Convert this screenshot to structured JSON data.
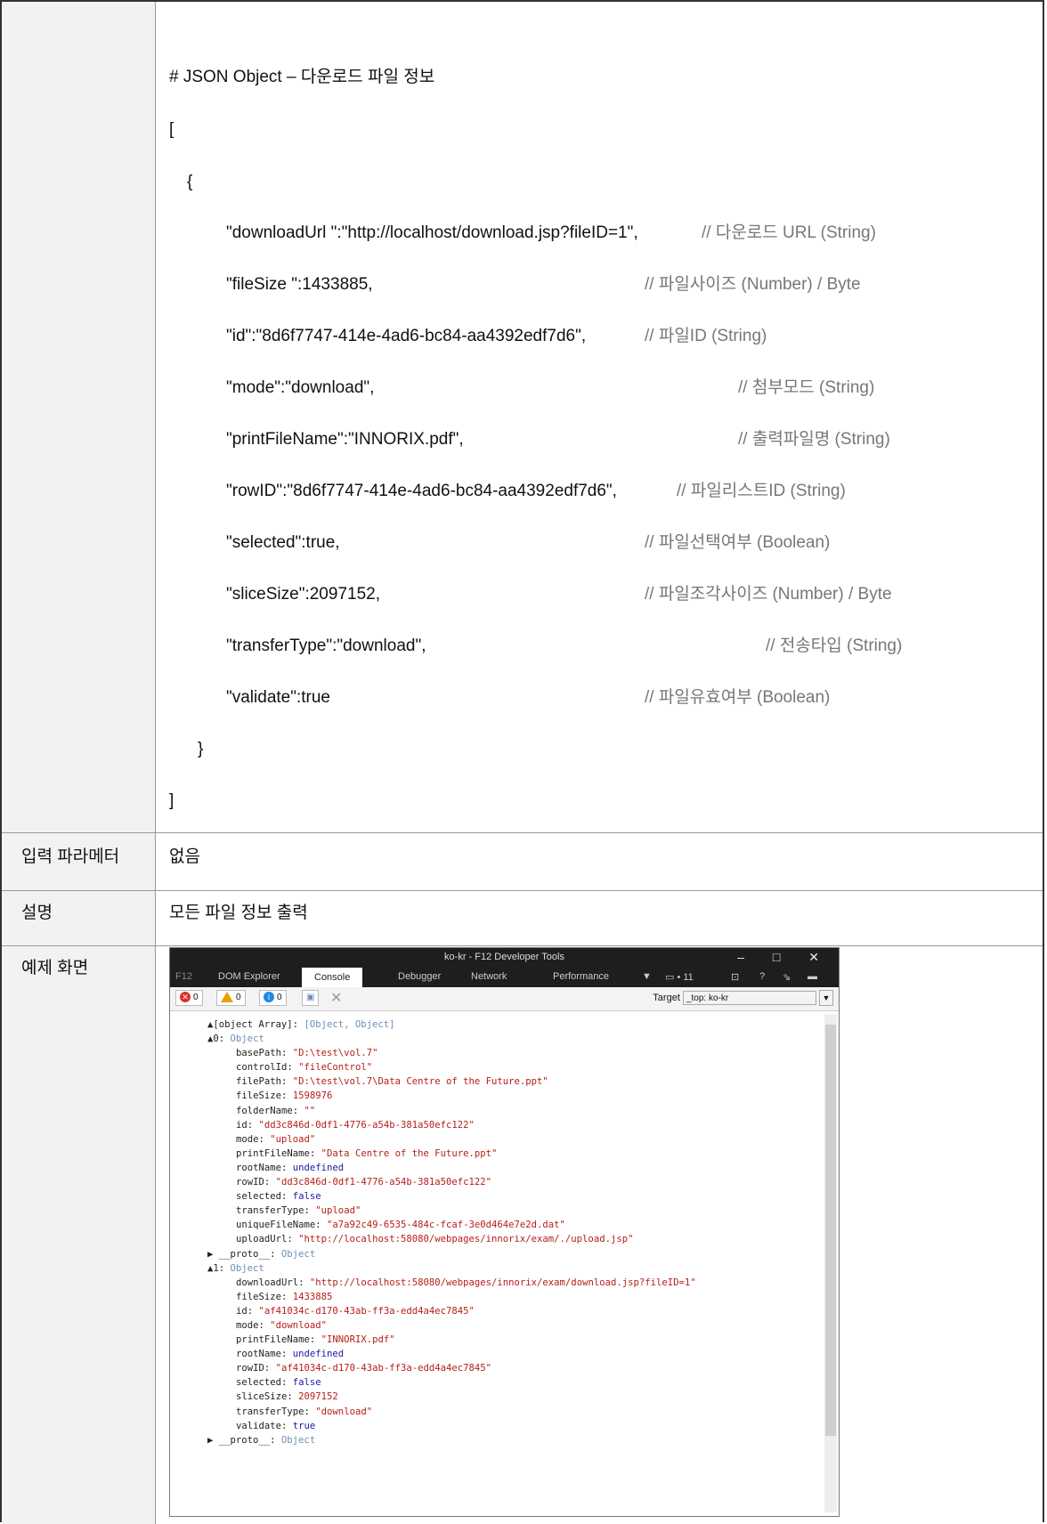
{
  "code_block": {
    "heading": "# JSON Object – 다운로드 파일 정보",
    "open_bracket": "[",
    "open_brace": "{",
    "lines": [
      {
        "code": "\"downloadUrl \":\"http://localhost/download.jsp?fileID=1\",",
        "comment": "// 다운로드 URL (String)"
      },
      {
        "code": "\"fileSize \":1433885,",
        "comment": "// 파일사이즈 (Number) / Byte"
      },
      {
        "code": "\"id\":\"8d6f7747-414e-4ad6-bc84-aa4392edf7d6\",",
        "comment": "// 파일ID (String)"
      },
      {
        "code": "\"mode\":\"download\",",
        "comment": "// 첨부모드 (String)"
      },
      {
        "code": "\"printFileName\":\"INNORIX.pdf\",",
        "comment": "// 출력파일명 (String)"
      },
      {
        "code": "\"rowID\":\"8d6f7747-414e-4ad6-bc84-aa4392edf7d6\",",
        "comment": "// 파일리스트ID (String)"
      },
      {
        "code": "\"selected\":true,",
        "comment": "// 파일선택여부 (Boolean)"
      },
      {
        "code": "\"sliceSize\":2097152,",
        "comment": "// 파일조각사이즈 (Number) / Byte"
      },
      {
        "code": "\"transferType\":\"download\",",
        "comment": "// 전송타입 (String)"
      },
      {
        "code": "\"validate\":true",
        "comment": "// 파일유효여부 (Boolean)"
      }
    ],
    "close_brace": "}",
    "close_bracket": "]"
  },
  "rows": {
    "input_label": "입력 파라메터",
    "input_value": "없음",
    "desc_label": "설명",
    "desc_value": "모든 파일 정보 출력",
    "example_label": "예제 화면"
  },
  "devtools": {
    "title": "ko-kr - F12 Developer Tools",
    "window_controls": "– □ ✕",
    "tabs": [
      "F12",
      "DOM Explorer",
      "Console",
      "Debugger",
      "Network",
      "Performance",
      "▼",
      "▭ • 11",
      "⊡",
      "?",
      "⇘",
      "▬"
    ],
    "errors": "0",
    "warnings": "0",
    "infos": "0",
    "target_label": "Target",
    "target_value": "_top: ko-kr",
    "console_lines": [
      {
        "indent": 1,
        "key": "▲[object Array]:",
        "val": " [Object, Object]",
        "t": "o"
      },
      {
        "indent": 1,
        "key": "  ▲0:",
        "val": " Object",
        "t": "o"
      },
      {
        "indent": 2,
        "key": "basePath:",
        "val": " \"D:\\test\\vol.7\"",
        "t": "s"
      },
      {
        "indent": 2,
        "key": "controlId:",
        "val": " \"fileControl\"",
        "t": "s"
      },
      {
        "indent": 2,
        "key": "filePath:",
        "val": " \"D:\\test\\vol.7\\Data Centre of the Future.ppt\"",
        "t": "s"
      },
      {
        "indent": 2,
        "key": "fileSize:",
        "val": " 1598976",
        "t": "s"
      },
      {
        "indent": 2,
        "key": "folderName:",
        "val": " \"\"",
        "t": "s"
      },
      {
        "indent": 2,
        "key": "id:",
        "val": " \"dd3c846d-0df1-4776-a54b-381a50efc122\"",
        "t": "s"
      },
      {
        "indent": 2,
        "key": "mode:",
        "val": " \"upload\"",
        "t": "s"
      },
      {
        "indent": 2,
        "key": "printFileName:",
        "val": " \"Data Centre of the Future.ppt\"",
        "t": "s"
      },
      {
        "indent": 2,
        "key": "rootName:",
        "val": " undefined",
        "t": "n"
      },
      {
        "indent": 2,
        "key": "rowID:",
        "val": " \"dd3c846d-0df1-4776-a54b-381a50efc122\"",
        "t": "s"
      },
      {
        "indent": 2,
        "key": "selected:",
        "val": " false",
        "t": "n"
      },
      {
        "indent": 2,
        "key": "transferType:",
        "val": " \"upload\"",
        "t": "s"
      },
      {
        "indent": 2,
        "key": "uniqueFileName:",
        "val": " \"a7a92c49-6535-484c-fcaf-3e0d464e7e2d.dat\"",
        "t": "s"
      },
      {
        "indent": 2,
        "key": "uploadUrl:",
        "val": " \"http://localhost:58080/webpages/innorix/exam/./upload.jsp\"",
        "t": "s"
      },
      {
        "indent": 1,
        "key": "     ▶ __proto__:",
        "val": " Object",
        "t": "o"
      },
      {
        "indent": 1,
        "key": "  ▲1:",
        "val": " Object",
        "t": "o"
      },
      {
        "indent": 2,
        "key": "downloadUrl:",
        "val": " \"http://localhost:58080/webpages/innorix/exam/download.jsp?fileID=1\"",
        "t": "s"
      },
      {
        "indent": 2,
        "key": "fileSize:",
        "val": " 1433885",
        "t": "s"
      },
      {
        "indent": 2,
        "key": "id:",
        "val": " \"af41034c-d170-43ab-ff3a-edd4a4ec7845\"",
        "t": "s"
      },
      {
        "indent": 2,
        "key": "mode:",
        "val": " \"download\"",
        "t": "s"
      },
      {
        "indent": 2,
        "key": "printFileName:",
        "val": " \"INNORIX.pdf\"",
        "t": "s"
      },
      {
        "indent": 2,
        "key": "rootName:",
        "val": " undefined",
        "t": "n"
      },
      {
        "indent": 2,
        "key": "rowID:",
        "val": " \"af41034c-d170-43ab-ff3a-edd4a4ec7845\"",
        "t": "s"
      },
      {
        "indent": 2,
        "key": "selected:",
        "val": " false",
        "t": "n"
      },
      {
        "indent": 2,
        "key": "sliceSize:",
        "val": " 2097152",
        "t": "s"
      },
      {
        "indent": 2,
        "key": "transferType:",
        "val": " \"download\"",
        "t": "s"
      },
      {
        "indent": 2,
        "key": "validate:",
        "val": " true",
        "t": "n"
      },
      {
        "indent": 1,
        "key": "     ▶ __proto__:",
        "val": " Object",
        "t": "o"
      }
    ]
  }
}
